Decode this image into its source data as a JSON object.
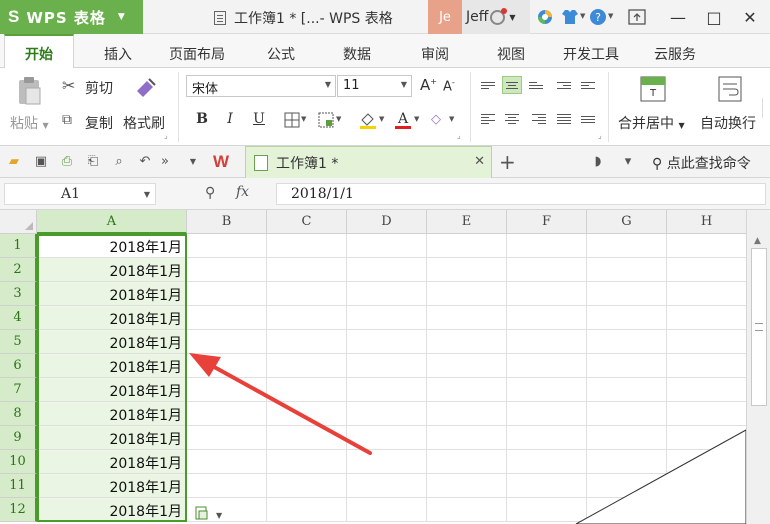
{
  "titlebar": {
    "app_logo": "S",
    "app_name": "WPS 表格",
    "doc_title": "工作簿1 * [...- WPS 表格",
    "avatar_text": "Je",
    "user_name": "Jeff",
    "icons": [
      "app-menu-caret-icon",
      "document-icon",
      "crown-icon",
      "browser-icon",
      "skin-icon",
      "help-icon",
      "restore-icon",
      "minimize-icon",
      "maximize-icon",
      "close-icon"
    ]
  },
  "ribbon_tabs": [
    "开始",
    "插入",
    "页面布局",
    "公式",
    "数据",
    "审阅",
    "视图",
    "开发工具",
    "云服务"
  ],
  "ribbon": {
    "paste_label": "粘贴",
    "cut_label": "剪切",
    "copy_label": "复制",
    "format_painter_label": "格式刷",
    "font_name": "宋体",
    "font_size": "11",
    "bold": "B",
    "italic": "I",
    "underline": "U",
    "merge_label": "合并居中",
    "wrap_label": "自动换行",
    "accent_color": "#5b9e3a"
  },
  "quickbar": {
    "doc_tab_label": "工作簿1 *",
    "new_tab": "+",
    "search_command": "点此查找命令"
  },
  "formula_bar": {
    "name_box": "A1",
    "fx": "fx",
    "value": "2018/1/1"
  },
  "sheet": {
    "columns": [
      "A",
      "B",
      "C",
      "D",
      "E",
      "F",
      "G",
      "H"
    ],
    "rows": [
      "1",
      "2",
      "3",
      "4",
      "5",
      "6",
      "7",
      "8",
      "9",
      "10",
      "11",
      "12"
    ],
    "column_a_values": [
      "2018年1月",
      "2018年1月",
      "2018年1月",
      "2018年1月",
      "2018年1月",
      "2018年1月",
      "2018年1月",
      "2018年1月",
      "2018年1月",
      "2018年1月",
      "2018年1月",
      "2018年1月"
    ],
    "selection_color": "#4b9a2c",
    "annotation_arrow_color": "#e8413a"
  }
}
